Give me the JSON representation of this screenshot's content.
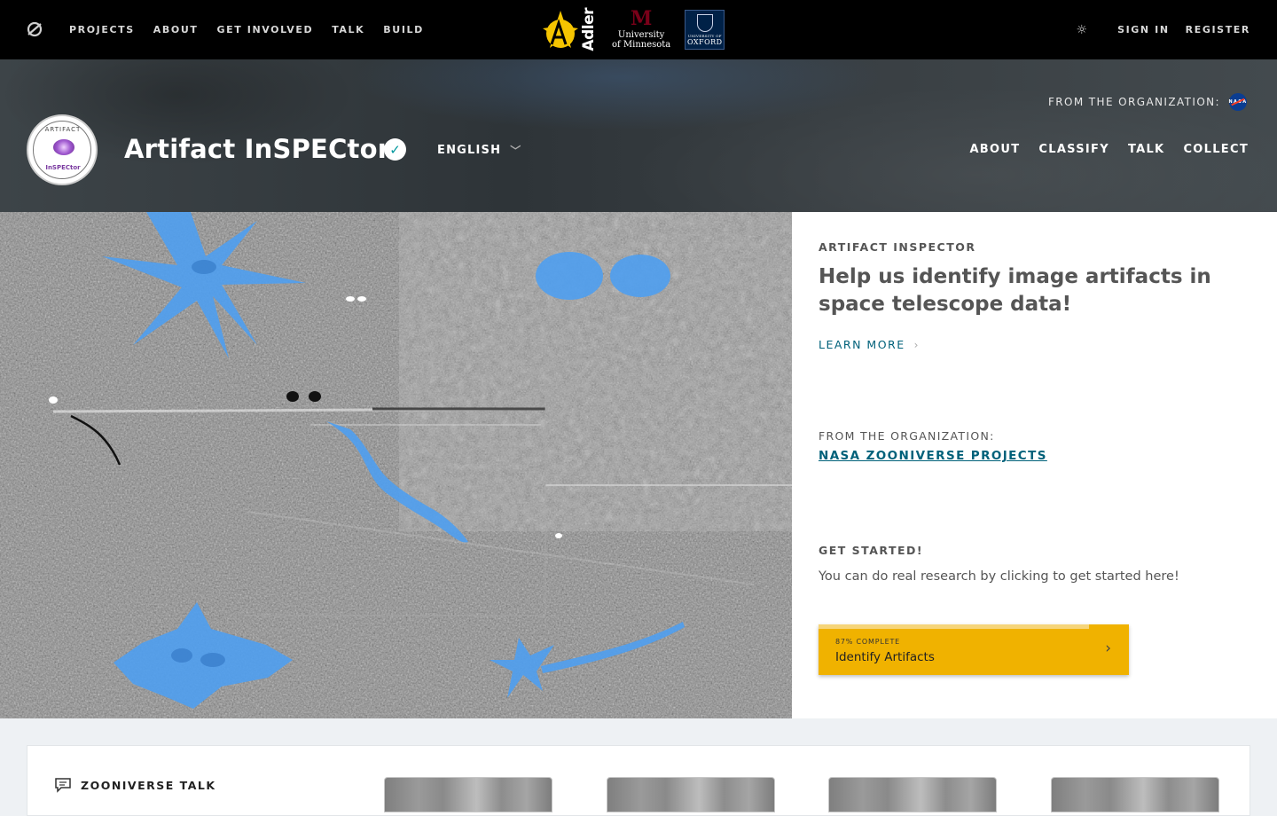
{
  "topnav": {
    "links": [
      "PROJECTS",
      "ABOUT",
      "GET INVOLVED",
      "TALK",
      "BUILD"
    ],
    "partners": {
      "adler": "Adler",
      "umn_line1": "University",
      "umn_line2": "of Minnesota",
      "oxford_small": "UNIVERSITY OF",
      "oxford": "OXFORD"
    },
    "sign_in": "SIGN IN",
    "register": "REGISTER"
  },
  "project": {
    "title": "Artifact InSPECtor",
    "language": "ENGLISH",
    "from_org_label": "FROM THE ORGANIZATION:",
    "nav": [
      "ABOUT",
      "CLASSIFY",
      "TALK",
      "COLLECT"
    ],
    "avatar_text_top": "ARTIFACT",
    "avatar_text_bottom": "InSPECtor"
  },
  "panel": {
    "eyebrow": "ARTIFACT INSPECTOR",
    "headline": "Help us identify image artifacts in space telescope data!",
    "learn_more": "LEARN MORE",
    "from_org_label": "FROM THE ORGANIZATION:",
    "org_name": "NASA ZOONIVERSE PROJECTS",
    "get_started_label": "GET STARTED!",
    "get_started_text": "You can do real research by clicking to get started here!",
    "workflow": {
      "percent_label": "87% COMPLETE",
      "progress": 0.87,
      "label": "Identify Artifacts"
    }
  },
  "talk": {
    "title": "ZOONIVERSE TALK"
  },
  "colors": {
    "accent_teal": "#00617a",
    "workflow_gold": "#f0b200",
    "mask_blue": "#4f9ff0"
  }
}
